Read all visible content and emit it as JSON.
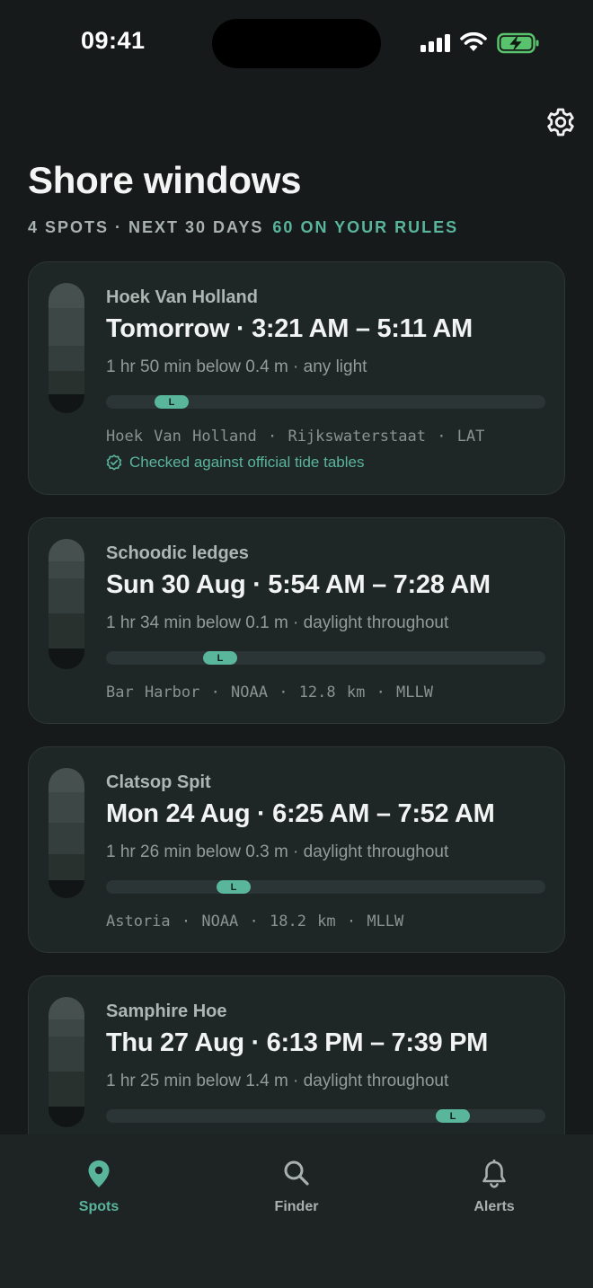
{
  "status": {
    "time": "09:41"
  },
  "header": {
    "title": "Shore windows",
    "subtitle": "4 SPOTS · NEXT 30 DAYS",
    "subtitle_accent": "60 ON YOUR RULES"
  },
  "cards": [
    {
      "spot": "Hoek Van Holland",
      "window": "Tomorrow · 3:21 AM – 5:11 AM",
      "detail": "1 hr 50 min below 0.4 m · any light",
      "low_tide_position": 0.15,
      "meta": "Hoek Van Holland · Rijkswaterstaat · LAT",
      "verified": "Checked against official tide tables"
    },
    {
      "spot": "Schoodic ledges",
      "window": "Sun 30 Aug · 5:54 AM – 7:28 AM",
      "detail": "1 hr 34 min below 0.1 m · daylight throughout",
      "low_tide_position": 0.26,
      "meta": "Bar Harbor · NOAA · 12.8 km · MLLW"
    },
    {
      "spot": "Clatsop Spit",
      "window": "Mon 24 Aug · 6:25 AM – 7:52 AM",
      "detail": "1 hr 26 min below 0.3 m · daylight throughout",
      "low_tide_position": 0.29,
      "meta": "Astoria · NOAA · 18.2 km · MLLW"
    },
    {
      "spot": "Samphire Hoe",
      "window": "Thu 27 Aug · 6:13 PM – 7:39 PM",
      "detail": "1 hr 25 min below 1.4 m · daylight throughout",
      "low_tide_position": 0.79,
      "meta": ""
    }
  ],
  "low_tide_marker": "L",
  "tabs": [
    {
      "label": "Spots",
      "icon": "location-pin-icon",
      "active": true
    },
    {
      "label": "Finder",
      "icon": "search-icon",
      "active": false
    },
    {
      "label": "Alerts",
      "icon": "bell-icon",
      "active": false
    }
  ],
  "colors": {
    "accent": "#59b69a",
    "background": "#161a1a",
    "card": "#1f2626"
  }
}
